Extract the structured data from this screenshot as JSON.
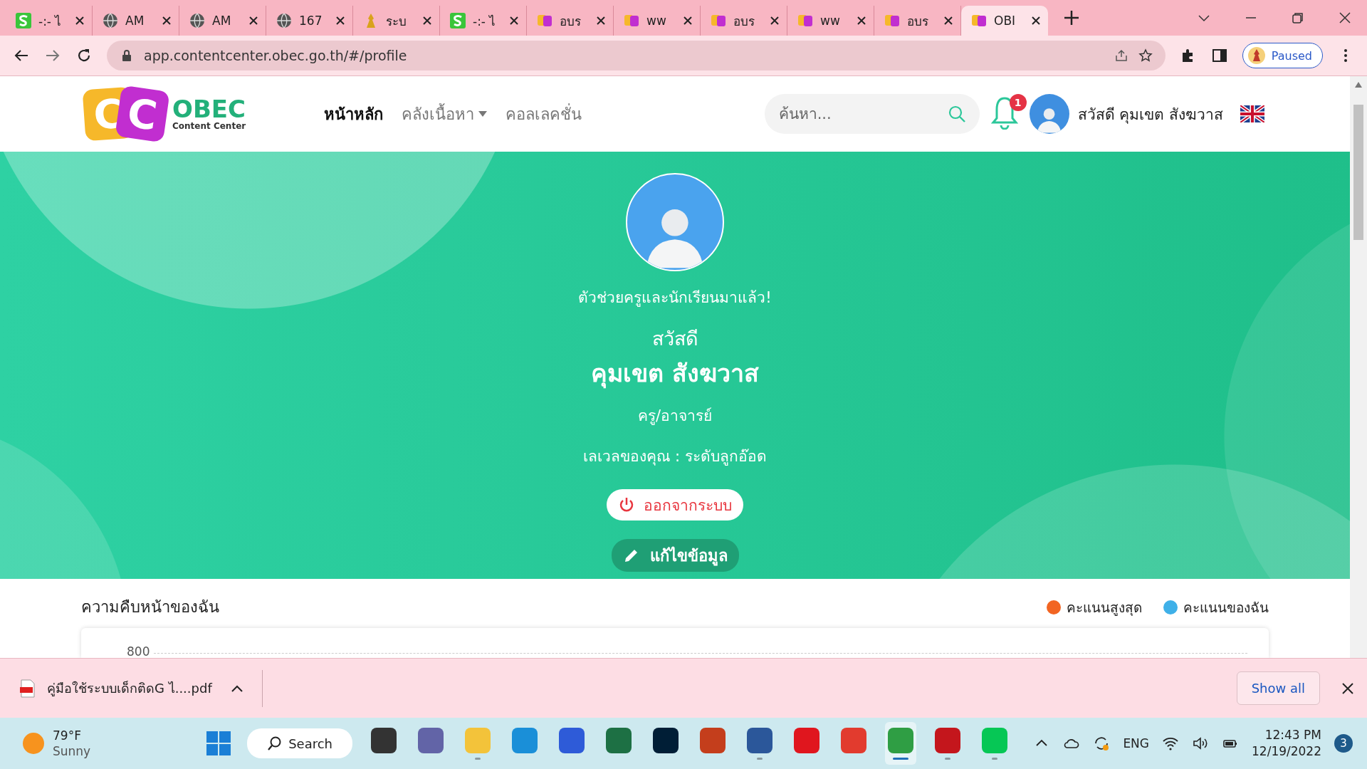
{
  "browser": {
    "tabs": [
      {
        "kind": "s",
        "title": "-:- ไ",
        "selected": false
      },
      {
        "kind": "globe",
        "title": "AM",
        "selected": false
      },
      {
        "kind": "globe",
        "title": "AM",
        "selected": false
      },
      {
        "kind": "globe",
        "title": "167",
        "selected": false
      },
      {
        "kind": "emblem",
        "title": "ระบ",
        "selected": false
      },
      {
        "kind": "s",
        "title": "-:- ไ",
        "selected": false
      },
      {
        "kind": "cc",
        "title": "อบร",
        "selected": false
      },
      {
        "kind": "cc",
        "title": "ww",
        "selected": false
      },
      {
        "kind": "cc",
        "title": "อบร",
        "selected": false
      },
      {
        "kind": "cc",
        "title": "ww",
        "selected": false
      },
      {
        "kind": "cc",
        "title": "อบร",
        "selected": false
      },
      {
        "kind": "cc",
        "title": "OBI",
        "selected": true
      }
    ],
    "url": "app.contentcenter.obec.go.th/#/profile",
    "profile_status": "Paused"
  },
  "site": {
    "logo": {
      "letters": [
        "C",
        "C"
      ],
      "name": "OBEC",
      "subtitle": "Content Center"
    },
    "nav": [
      {
        "label": "หน้าหลัก",
        "selected": true,
        "has_menu": false
      },
      {
        "label": "คลังเนื้อหา",
        "selected": false,
        "has_menu": true
      },
      {
        "label": "คอลเลคชั่น",
        "selected": false,
        "has_menu": false
      }
    ],
    "search": {
      "placeholder": "ค้นหา..."
    },
    "notification_count": "1",
    "user_greeting": "สวัสดี คุมเขต สังฆวาส"
  },
  "profile": {
    "tagline": "ตัวช่วยครูและนักเรียนมาแล้ว!",
    "hello": "สวัสดี",
    "name": "คุมเขต สังฆวาส",
    "role": "ครู/อาจารย์",
    "level": "เลเวลของคุณ : ระดับลูกอ๊อด",
    "logout_button": "ออกจากระบบ",
    "edit_button": "แก้ไขข้อมูล"
  },
  "progress": {
    "title": "ความคืบหน้าของฉัน",
    "legend": [
      {
        "label": "คะแนนสูงสุด",
        "color": "#f26522"
      },
      {
        "label": "คะแนนของฉัน",
        "color": "#3fb0e8"
      }
    ],
    "chart_top_tick": "800"
  },
  "download_bar": {
    "file": "คู่มือใช้ระบบเด็กติดG ไ....pdf",
    "show_all": "Show all"
  },
  "taskbar": {
    "weather": {
      "temp": "79°F",
      "condition": "Sunny"
    },
    "search": "Search",
    "apps": [
      {
        "kind": "taskview",
        "running": false,
        "selected": false
      },
      {
        "kind": "teams",
        "running": false,
        "selected": false
      },
      {
        "kind": "explorer",
        "running": true,
        "selected": false
      },
      {
        "kind": "edge",
        "running": false,
        "selected": false
      },
      {
        "kind": "mathtype",
        "running": false,
        "selected": false
      },
      {
        "kind": "excel",
        "running": false,
        "selected": false
      },
      {
        "kind": "photoshop",
        "running": false,
        "selected": false
      },
      {
        "kind": "powerpoint",
        "running": false,
        "selected": false
      },
      {
        "kind": "word",
        "running": true,
        "selected": false
      },
      {
        "kind": "opera",
        "running": false,
        "selected": false
      },
      {
        "kind": "wps",
        "running": false,
        "selected": false
      },
      {
        "kind": "chrome",
        "running": true,
        "selected": true
      },
      {
        "kind": "acrobat",
        "running": true,
        "selected": false
      },
      {
        "kind": "line",
        "running": true,
        "selected": false
      }
    ],
    "language": "ENG",
    "time": "12:43 PM",
    "date": "12/19/2022",
    "notifications": "3"
  }
}
